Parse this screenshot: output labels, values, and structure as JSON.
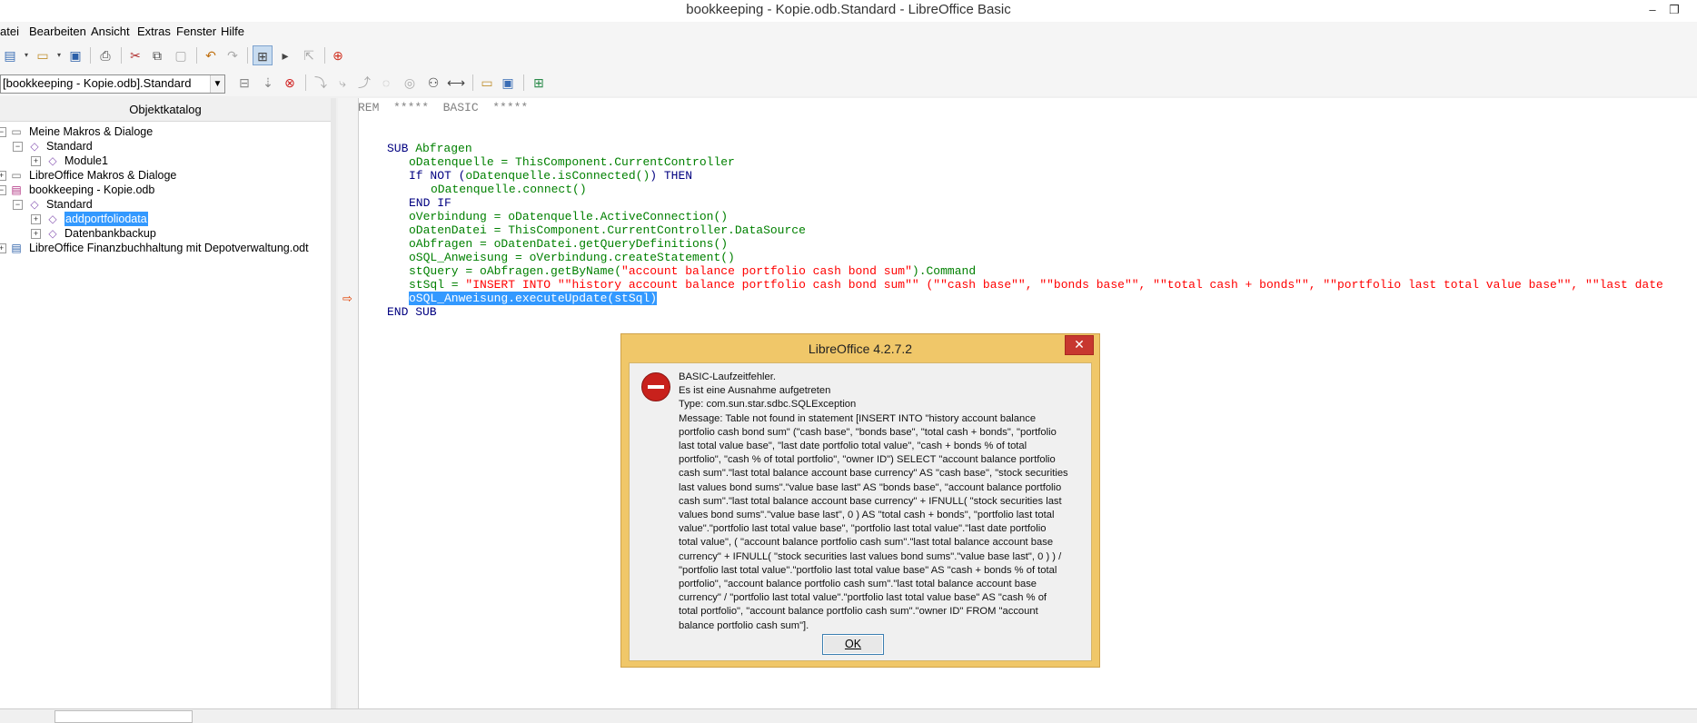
{
  "window": {
    "title": "bookkeeping - Kopie.odb.Standard - LibreOffice Basic",
    "minimize": "–",
    "restore": "❐"
  },
  "menu": [
    "atei",
    "Bearbeiten",
    "Ansicht",
    "Extras",
    "Fenster",
    "Hilfe"
  ],
  "library_selector": {
    "value": "[bookkeeping - Kopie.odb].Standard",
    "arrow": "▼"
  },
  "object_catalog": {
    "header": "Objektkatalog",
    "items": [
      {
        "label": "Meine Makros & Dialoge",
        "expander": "−"
      },
      {
        "label": "Standard",
        "expander": "−"
      },
      {
        "label": "Module1",
        "expander": "+"
      },
      {
        "label": "LibreOffice Makros & Dialoge",
        "expander": "+"
      },
      {
        "label": "bookkeeping - Kopie.odb",
        "expander": "−"
      },
      {
        "label": "Standard",
        "expander": "−"
      },
      {
        "label": "addportfoliodata",
        "expander": "+"
      },
      {
        "label": "Datenbankbackup",
        "expander": "+"
      },
      {
        "label": "LibreOffice  Finanzbuchhaltung mit Depotverwaltung.odt",
        "expander": "+"
      }
    ]
  },
  "code": {
    "l1_rem": "REM  *****  BASIC  *****",
    "l2_sub": "SUB",
    "l2_name": " Abfragen",
    "l3": "oDatenquelle = ThisComponent.CurrentController",
    "l4_if": "If NOT (",
    "l4_id": "oDatenquelle.isConnected()",
    "l4_then": ") THEN",
    "l5": "oDatenquelle.connect()",
    "l6": "END IF",
    "l7": "oVerbindung = oDatenquelle.ActiveConnection()",
    "l8": "oDatenDatei = ThisComponent.CurrentController.DataSource",
    "l9": "oAbfragen = oDatenDatei.getQueryDefinitions()",
    "l10": "oSQL_Anweisung = oVerbindung.createStatement()",
    "l11_a": "stQuery = oAbfragen.getByName(",
    "l11_str": "\"account balance portfolio cash bond sum\"",
    "l11_b": ").Command",
    "l12_a": "stSql = ",
    "l12_str": "\"INSERT INTO \"\"history account balance portfolio cash bond sum\"\" (\"\"cash base\"\", \"\"bonds base\"\", \"\"total cash + bonds\"\", \"\"portfolio last total value base\"\", \"\"last date",
    "l13": "oSQL_Anweisung.executeUpdate(stSql)",
    "l14": "END SUB",
    "breakpoint_marker": "⇨"
  },
  "dialog": {
    "title": "LibreOffice 4.2.7.2",
    "close": "✕",
    "lines": [
      "BASIC-Laufzeitfehler.",
      "Es ist eine Ausnahme aufgetreten",
      "Type: com.sun.star.sdbc.SQLException",
      "Message: Table not found in statement [INSERT INTO \"history account balance",
      "portfolio cash bond sum\" (\"cash base\", \"bonds base\", \"total cash + bonds\", \"portfolio",
      "last total value base\", \"last date portfolio total value\", \"cash + bonds % of total",
      "portfolio\", \"cash % of total portfolio\", \"owner ID\") SELECT \"account balance portfolio",
      "cash sum\".\"last total balance account base currency\" AS \"cash base\", \"stock securities",
      "last values bond sums\".\"value base last\" AS \"bonds base\", \"account balance portfolio",
      "cash sum\".\"last total balance account base currency\" + IFNULL( \"stock securities last",
      "values bond sums\".\"value base last\", 0 ) AS \"total cash + bonds\", \"portfolio last total",
      "value\".\"portfolio last total value base\", \"portfolio last total value\".\"last date portfolio",
      "total value\", ( \"account balance portfolio cash sum\".\"last total balance account base",
      "currency\" + IFNULL( \"stock securities last values bond sums\".\"value base last\", 0 ) ) /",
      "\"portfolio last total value\".\"portfolio last total value base\" AS \"cash + bonds % of total",
      "portfolio\", \"account balance portfolio cash sum\".\"last total balance account base",
      "currency\" / \"portfolio last total value\".\"portfolio last total value base\" AS \"cash % of",
      "total portfolio\", \"account balance portfolio cash sum\".\"owner ID\" FROM      \"account",
      "balance portfolio cash sum\"]."
    ],
    "ok": "OK"
  },
  "colors": {
    "keyword": "#000080",
    "identifier": "#008000",
    "string": "#ff0000",
    "selection": "#3399ff",
    "dialog_frame": "#f0c769",
    "error_icon": "#c8211c"
  }
}
